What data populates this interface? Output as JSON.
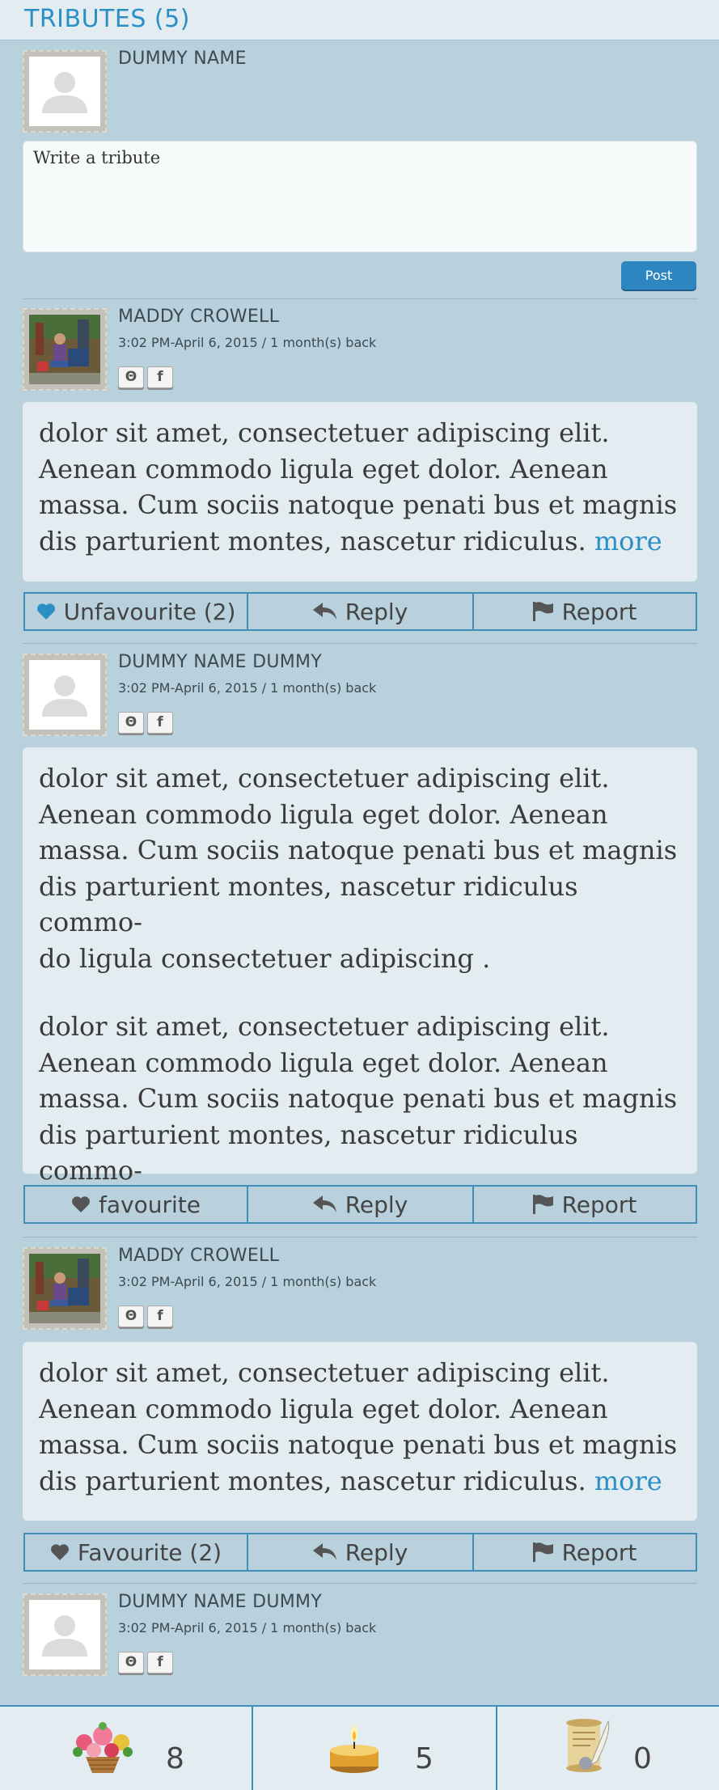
{
  "header": {
    "title": "TRIBUTES (5)"
  },
  "composer": {
    "user_name": "DUMMY NAME",
    "placeholder": "Write a tribute",
    "post_label": "Post"
  },
  "tributes": [
    {
      "author": "MADDY CROWELL",
      "meta": "3:02 PM-April 6, 2015 / 1 month(s) back",
      "avatar": "photo",
      "social": [
        "Θ",
        "f"
      ],
      "paragraphs": [
        "dolor sit amet, consectetuer adipiscing elit.\nAenean commodo ligula eget dolor. Aenean\nmassa. Cum sociis natoque penati bus et magnis\ndis parturient montes, nascetur ridiculus. "
      ],
      "more_label": "more",
      "actions": {
        "favourite_label": "Unfavourite (2)",
        "reply_label": "Reply",
        "report_label": "Report",
        "favourited": true
      }
    },
    {
      "author": "DUMMY NAME DUMMY",
      "meta": "3:02 PM-April 6, 2015 / 1 month(s) back",
      "avatar": "placeholder",
      "social": [
        "Θ",
        "f"
      ],
      "paragraphs": [
        "dolor sit amet, consectetuer adipiscing elit.\nAenean commodo ligula eget dolor. Aenean\nmassa. Cum sociis natoque penati bus et magnis\ndis parturient montes, nascetur ridiculus commo-\ndo ligula consectetuer adipiscing .",
        "dolor sit amet, consectetuer adipiscing elit.\nAenean commodo ligula eget dolor. Aenean\nmassa. Cum sociis natoque penati bus et magnis\ndis parturient montes, nascetur ridiculus commo-\ndo ligula consectetuer adipiscing ."
      ],
      "actions": {
        "favourite_label": "favourite",
        "reply_label": "Reply",
        "report_label": "Report",
        "favourited": false
      }
    },
    {
      "author": "MADDY CROWELL",
      "meta": "3:02 PM-April 6, 2015 / 1 month(s) back",
      "avatar": "photo",
      "social": [
        "Θ",
        "f"
      ],
      "paragraphs": [
        "dolor sit amet, consectetuer adipiscing elit.\nAenean commodo ligula eget dolor. Aenean\nmassa. Cum sociis natoque penati bus et magnis\ndis parturient montes, nascetur ridiculus. "
      ],
      "more_label": "more",
      "actions": {
        "favourite_label": "Favourite (2)",
        "reply_label": "Reply",
        "report_label": "Report",
        "favourited": false
      }
    },
    {
      "author": "DUMMY NAME DUMMY",
      "meta": "3:02 PM-April 6, 2015 / 1 month(s) back",
      "avatar": "placeholder",
      "social": [
        "Θ",
        "f"
      ]
    }
  ],
  "footer": {
    "flowers": {
      "icon": "flower-bouquet-icon",
      "count": "8"
    },
    "candles": {
      "icon": "candle-icon",
      "count": "5"
    },
    "notes": {
      "icon": "scroll-quill-icon",
      "count": "0"
    }
  },
  "colors": {
    "accent": "#2a8fc4",
    "background": "#b8d1dc",
    "panel": "#e3ecf1",
    "border": "#3f8fb9",
    "button": "#2d86c0",
    "heart_active": "#2a8fc4",
    "heart_inactive": "#555555"
  }
}
